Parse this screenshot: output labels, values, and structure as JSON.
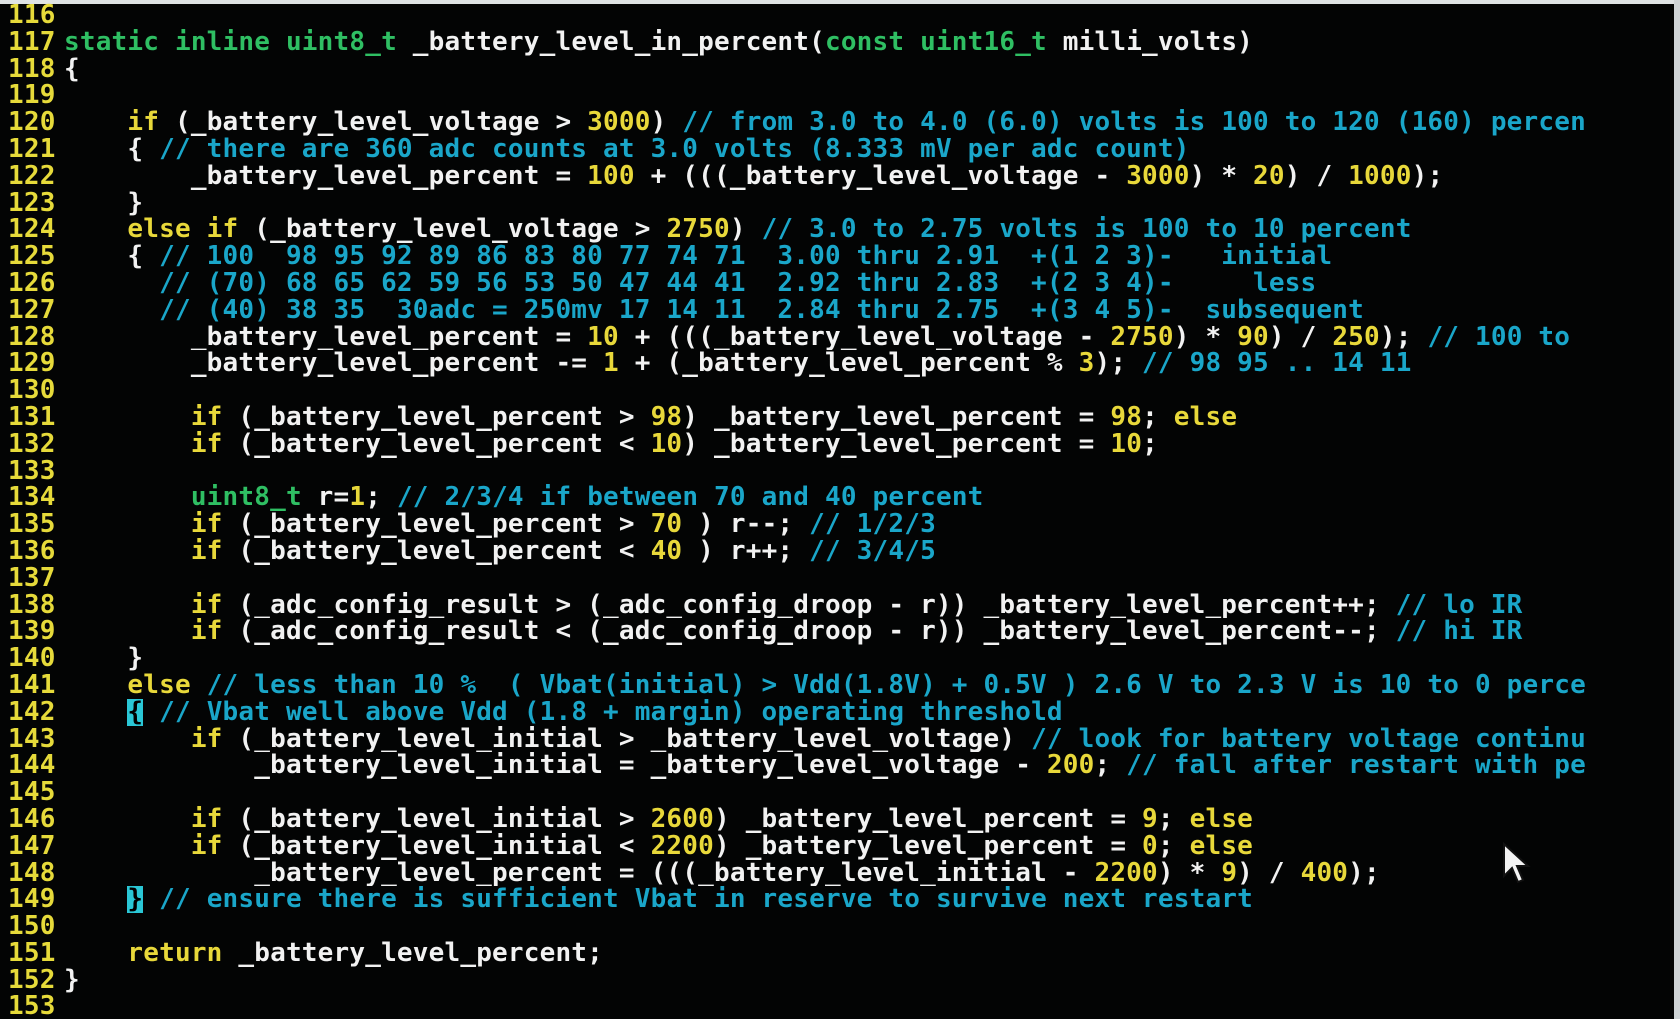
{
  "editor": {
    "colors": {
      "background": "#030404",
      "line_number": "#e6da3a",
      "identifier": "#f2f2f2",
      "type_keyword": "#2fbf63",
      "keyword": "#e8d83a",
      "comment": "#1aa6c9",
      "number": "#e8d83a"
    },
    "lines": [
      {
        "n": "116",
        "segs": []
      },
      {
        "n": "117",
        "segs": [
          {
            "c": "g",
            "t": "static inline uint8_t "
          },
          {
            "c": "w",
            "t": "_battery_level_in_percent("
          },
          {
            "c": "g",
            "t": "const uint16_t "
          },
          {
            "c": "w",
            "t": "milli_volts)"
          }
        ]
      },
      {
        "n": "118",
        "segs": [
          {
            "c": "w",
            "t": "{"
          }
        ]
      },
      {
        "n": "119",
        "segs": []
      },
      {
        "n": "120",
        "segs": [
          {
            "c": "y",
            "t": "    if "
          },
          {
            "c": "w",
            "t": "(_battery_level_voltage > "
          },
          {
            "c": "n",
            "t": "3000"
          },
          {
            "c": "w",
            "t": ") "
          },
          {
            "c": "c",
            "t": "// from 3.0 to 4.0 (6.0) volts is 100 to 120 (160) percen"
          }
        ]
      },
      {
        "n": "121",
        "segs": [
          {
            "c": "w",
            "t": "    { "
          },
          {
            "c": "c",
            "t": "// there are 360 adc counts at 3.0 volts (8.333 mV per adc count)"
          }
        ]
      },
      {
        "n": "122",
        "segs": [
          {
            "c": "w",
            "t": "        _battery_level_percent = "
          },
          {
            "c": "n",
            "t": "100"
          },
          {
            "c": "w",
            "t": " + (((_battery_level_voltage - "
          },
          {
            "c": "n",
            "t": "3000"
          },
          {
            "c": "w",
            "t": ") * "
          },
          {
            "c": "n",
            "t": "20"
          },
          {
            "c": "w",
            "t": ") / "
          },
          {
            "c": "n",
            "t": "1000"
          },
          {
            "c": "w",
            "t": ");"
          }
        ]
      },
      {
        "n": "123",
        "segs": [
          {
            "c": "w",
            "t": "    }"
          }
        ]
      },
      {
        "n": "124",
        "segs": [
          {
            "c": "y",
            "t": "    else if "
          },
          {
            "c": "w",
            "t": "(_battery_level_voltage > "
          },
          {
            "c": "n",
            "t": "2750"
          },
          {
            "c": "w",
            "t": ") "
          },
          {
            "c": "c",
            "t": "// 3.0 to 2.75 volts is 100 to 10 percent"
          }
        ]
      },
      {
        "n": "125",
        "segs": [
          {
            "c": "w",
            "t": "    { "
          },
          {
            "c": "c",
            "t": "// 100  98 95 92 89 86 83 80 77 74 71  3.00 thru 2.91  +(1 2 3)-   initial"
          }
        ]
      },
      {
        "n": "126",
        "segs": [
          {
            "c": "c",
            "t": "      // (70) 68 65 62 59 56 53 50 47 44 41  2.92 thru 2.83  +(2 3 4)-     less"
          }
        ]
      },
      {
        "n": "127",
        "segs": [
          {
            "c": "c",
            "t": "      // (40) 38 35  30adc = 250mv 17 14 11  2.84 thru 2.75  +(3 4 5)-  subsequent"
          }
        ]
      },
      {
        "n": "128",
        "segs": [
          {
            "c": "w",
            "t": "        _battery_level_percent = "
          },
          {
            "c": "n",
            "t": "10"
          },
          {
            "c": "w",
            "t": " + (((_battery_level_voltage - "
          },
          {
            "c": "n",
            "t": "2750"
          },
          {
            "c": "w",
            "t": ") * "
          },
          {
            "c": "n",
            "t": "90"
          },
          {
            "c": "w",
            "t": ") / "
          },
          {
            "c": "n",
            "t": "250"
          },
          {
            "c": "w",
            "t": "); "
          },
          {
            "c": "c",
            "t": "// 100 to"
          }
        ]
      },
      {
        "n": "129",
        "segs": [
          {
            "c": "w",
            "t": "        _battery_level_percent -= "
          },
          {
            "c": "n",
            "t": "1"
          },
          {
            "c": "w",
            "t": " + (_battery_level_percent % "
          },
          {
            "c": "n",
            "t": "3"
          },
          {
            "c": "w",
            "t": "); "
          },
          {
            "c": "c",
            "t": "// 98 95 .. 14 11"
          }
        ]
      },
      {
        "n": "130",
        "segs": []
      },
      {
        "n": "131",
        "segs": [
          {
            "c": "y",
            "t": "        if "
          },
          {
            "c": "w",
            "t": "(_battery_level_percent > "
          },
          {
            "c": "n",
            "t": "98"
          },
          {
            "c": "w",
            "t": ") _battery_level_percent = "
          },
          {
            "c": "n",
            "t": "98"
          },
          {
            "c": "w",
            "t": "; "
          },
          {
            "c": "y",
            "t": "else"
          }
        ]
      },
      {
        "n": "132",
        "segs": [
          {
            "c": "y",
            "t": "        if "
          },
          {
            "c": "w",
            "t": "(_battery_level_percent < "
          },
          {
            "c": "n",
            "t": "10"
          },
          {
            "c": "w",
            "t": ") _battery_level_percent = "
          },
          {
            "c": "n",
            "t": "10"
          },
          {
            "c": "w",
            "t": ";"
          }
        ]
      },
      {
        "n": "133",
        "segs": []
      },
      {
        "n": "134",
        "segs": [
          {
            "c": "g",
            "t": "        uint8_t "
          },
          {
            "c": "w",
            "t": "r="
          },
          {
            "c": "n",
            "t": "1"
          },
          {
            "c": "w",
            "t": "; "
          },
          {
            "c": "c",
            "t": "// 2/3/4 if between 70 and 40 percent"
          }
        ]
      },
      {
        "n": "135",
        "segs": [
          {
            "c": "y",
            "t": "        if "
          },
          {
            "c": "w",
            "t": "(_battery_level_percent > "
          },
          {
            "c": "n",
            "t": "70"
          },
          {
            "c": "w",
            "t": " ) r--; "
          },
          {
            "c": "c",
            "t": "// 1/2/3"
          }
        ]
      },
      {
        "n": "136",
        "segs": [
          {
            "c": "y",
            "t": "        if "
          },
          {
            "c": "w",
            "t": "(_battery_level_percent < "
          },
          {
            "c": "n",
            "t": "40"
          },
          {
            "c": "w",
            "t": " ) r++; "
          },
          {
            "c": "c",
            "t": "// 3/4/5"
          }
        ]
      },
      {
        "n": "137",
        "segs": []
      },
      {
        "n": "138",
        "segs": [
          {
            "c": "y",
            "t": "        if "
          },
          {
            "c": "w",
            "t": "(_adc_config_result > (_adc_config_droop - r)) _battery_level_percent++; "
          },
          {
            "c": "c",
            "t": "// lo IR"
          }
        ]
      },
      {
        "n": "139",
        "segs": [
          {
            "c": "y",
            "t": "        if "
          },
          {
            "c": "w",
            "t": "(_adc_config_result < (_adc_config_droop - r)) _battery_level_percent--; "
          },
          {
            "c": "c",
            "t": "// hi IR"
          }
        ]
      },
      {
        "n": "140",
        "segs": [
          {
            "c": "w",
            "t": "    }"
          }
        ]
      },
      {
        "n": "141",
        "segs": [
          {
            "c": "y",
            "t": "    else "
          },
          {
            "c": "c",
            "t": "// less than 10 %  ( Vbat(initial) > Vdd(1.8V) + 0.5V ) 2.6 V to 2.3 V is 10 to 0 perce"
          }
        ]
      },
      {
        "n": "142",
        "segs": [
          {
            "c": "w",
            "t": "    "
          },
          {
            "c": "k",
            "t": "{"
          },
          {
            "c": "c",
            "t": " // Vbat well above Vdd (1.8 + margin) operating threshold"
          }
        ]
      },
      {
        "n": "143",
        "segs": [
          {
            "c": "y",
            "t": "        if "
          },
          {
            "c": "w",
            "t": "(_battery_level_initial > _battery_level_voltage) "
          },
          {
            "c": "c",
            "t": "// look for battery voltage continu"
          }
        ]
      },
      {
        "n": "144",
        "segs": [
          {
            "c": "w",
            "t": "            _battery_level_initial = _battery_level_voltage - "
          },
          {
            "c": "n",
            "t": "200"
          },
          {
            "c": "w",
            "t": "; "
          },
          {
            "c": "c",
            "t": "// fall after restart with pe"
          }
        ]
      },
      {
        "n": "145",
        "segs": []
      },
      {
        "n": "146",
        "segs": [
          {
            "c": "y",
            "t": "        if "
          },
          {
            "c": "w",
            "t": "(_battery_level_initial > "
          },
          {
            "c": "n",
            "t": "2600"
          },
          {
            "c": "w",
            "t": ") _battery_level_percent = "
          },
          {
            "c": "n",
            "t": "9"
          },
          {
            "c": "w",
            "t": "; "
          },
          {
            "c": "y",
            "t": "else"
          }
        ]
      },
      {
        "n": "147",
        "segs": [
          {
            "c": "y",
            "t": "        if "
          },
          {
            "c": "w",
            "t": "(_battery_level_initial < "
          },
          {
            "c": "n",
            "t": "2200"
          },
          {
            "c": "w",
            "t": ") _battery_level_percent = "
          },
          {
            "c": "n",
            "t": "0"
          },
          {
            "c": "w",
            "t": "; "
          },
          {
            "c": "y",
            "t": "else"
          }
        ]
      },
      {
        "n": "148",
        "segs": [
          {
            "c": "w",
            "t": "            _battery_level_percent = (((_battery_level_initial - "
          },
          {
            "c": "n",
            "t": "2200"
          },
          {
            "c": "w",
            "t": ") * "
          },
          {
            "c": "n",
            "t": "9"
          },
          {
            "c": "w",
            "t": ") / "
          },
          {
            "c": "n",
            "t": "400"
          },
          {
            "c": "w",
            "t": ");"
          }
        ]
      },
      {
        "n": "149",
        "segs": [
          {
            "c": "w",
            "t": "    "
          },
          {
            "c": "k",
            "t": "}"
          },
          {
            "c": "c",
            "t": " // ensure there is sufficient Vbat in reserve to survive next restart"
          }
        ]
      },
      {
        "n": "150",
        "segs": []
      },
      {
        "n": "151",
        "segs": [
          {
            "c": "y",
            "t": "    return "
          },
          {
            "c": "w",
            "t": "_battery_level_percent;"
          }
        ]
      },
      {
        "n": "152",
        "segs": [
          {
            "c": "w",
            "t": "}"
          }
        ]
      },
      {
        "n": "153",
        "segs": []
      }
    ]
  },
  "icons": {
    "mouse": "mouse-pointer-icon"
  }
}
